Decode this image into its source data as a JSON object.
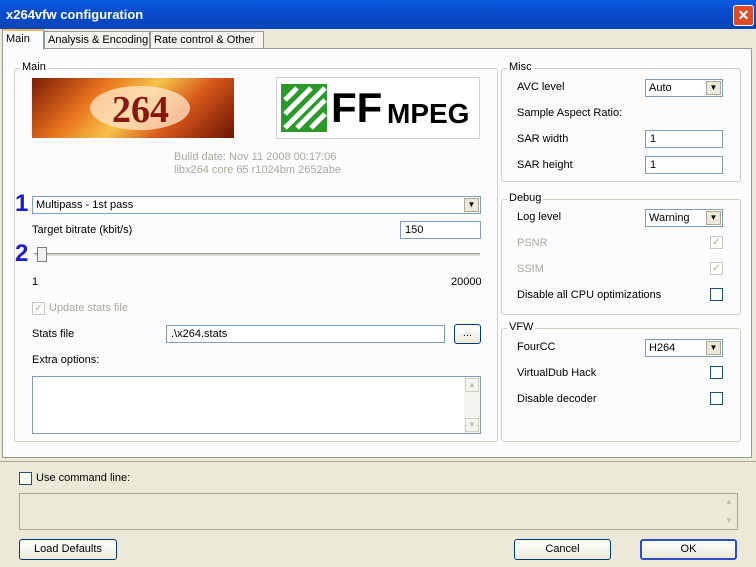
{
  "window": {
    "title": "x264vfw configuration",
    "close_glyph": "✕"
  },
  "tabs": [
    {
      "label": "Main"
    },
    {
      "label": "Analysis & Encoding"
    },
    {
      "label": "Rate control & Other"
    }
  ],
  "main_group": {
    "label": "Main",
    "logo_264": "264",
    "logo_ffmpeg_big": "FF",
    "logo_ffmpeg_small": "MPEG",
    "build_date": "Build date: Nov 11 2008 00:17:06",
    "core_info": "libx264 core 65 r1024bm 2652abe",
    "annotation_1": "1",
    "annotation_2": "2",
    "mode_select": "Multipass - 1st pass",
    "target_bitrate_label": "Target bitrate (kbit/s)",
    "target_bitrate_value": "150",
    "slider_min": "1",
    "slider_max": "20000",
    "slider_value_fraction": 0.0075,
    "update_stats_label": "Update stats file",
    "update_stats_checked": true,
    "stats_file_label": "Stats file",
    "stats_file_value": ".\\x264.stats",
    "browse_label": "...",
    "extra_options_label": "Extra options:",
    "extra_options_value": ""
  },
  "misc_group": {
    "label": "Misc",
    "avc_level_label": "AVC level",
    "avc_level_value": "Auto",
    "sar_label": "Sample Aspect Ratio:",
    "sar_width_label": "SAR width",
    "sar_width_value": "1",
    "sar_height_label": "SAR height",
    "sar_height_value": "1"
  },
  "debug_group": {
    "label": "Debug",
    "log_level_label": "Log level",
    "log_level_value": "Warning",
    "psnr_label": "PSNR",
    "ssim_label": "SSIM",
    "disable_cpu_label": "Disable all CPU optimizations",
    "check_glyph": "✓"
  },
  "vfw_group": {
    "label": "VFW",
    "fourcc_label": "FourCC",
    "fourcc_value": "H264",
    "virtualdub_label": "VirtualDub Hack",
    "disable_decoder_label": "Disable decoder"
  },
  "bottom": {
    "use_command_line_label": "Use command line:",
    "command_line_value": "",
    "load_defaults_label": "Load Defaults",
    "cancel_label": "Cancel",
    "ok_label": "OK"
  },
  "colors": {
    "titlebar": "#0a4ccf",
    "annotation": "#1c1ccc",
    "ffmpeg_green": "#2b9a2b"
  }
}
